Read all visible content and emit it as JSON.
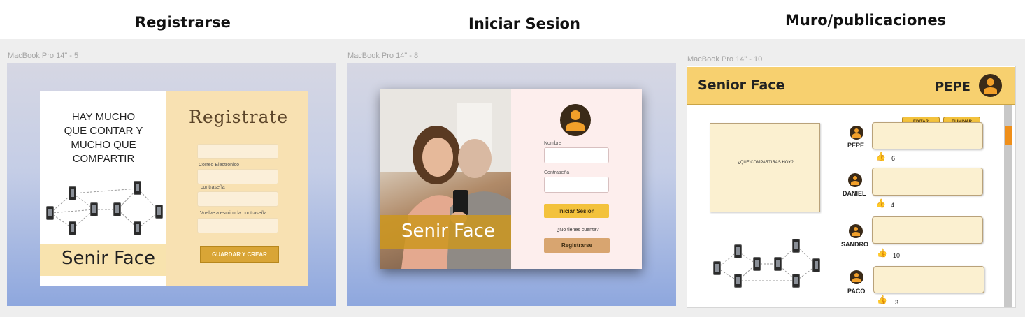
{
  "headings": {
    "register": "Registrarse",
    "login": "Iniciar Sesion",
    "wall": "Muro/publicaciones"
  },
  "frames": {
    "register": "MacBook Pro 14\" - 5",
    "login": "MacBook Pro 14\" - 8",
    "wall": "MacBook Pro 14\" - 10"
  },
  "register_screen": {
    "tagline": [
      "HAY MUCHO",
      "QUE CONTAR Y",
      "MUCHO QUE",
      "COMPARTIR"
    ],
    "brand": "Senir Face",
    "title": "Registrate",
    "email_label": "Correo Electronico",
    "password_label": "contraseña",
    "repeat_label": "Vuelve a escribir la contraseña",
    "submit_label": "GUARDAR Y CREAR"
  },
  "login_screen": {
    "brand": "Senir Face",
    "name_label": "Nombre",
    "password_label": "Contraseña",
    "login_button": "Iniciar Sesion",
    "no_account": "¿No tienes cuenta?",
    "register_button": "Registrarse"
  },
  "wall_screen": {
    "app_title": "Senior Face",
    "user_name": "PEPE",
    "composer_prompt": "¿QUE COMPARTIRAS HOY?",
    "edit_label": "EDITAR",
    "delete_label": "ELIMINAR",
    "posts": [
      {
        "author": "PEPE",
        "likes": "6"
      },
      {
        "author": "DANIEL",
        "likes": "4"
      },
      {
        "author": "SANDRO",
        "likes": "10"
      },
      {
        "author": "PACO",
        "likes": "3"
      }
    ]
  },
  "colors": {
    "accent": "#e2ac1f",
    "brand_band": "#f8e3ae",
    "wall_header": "#f7d06f",
    "register_button": "#d9a536",
    "login_button": "#f3c23c",
    "signup_button": "#d8a570"
  },
  "icons": [
    "user-avatar-icon",
    "thumbs-up-icon",
    "smartphone-icon"
  ]
}
